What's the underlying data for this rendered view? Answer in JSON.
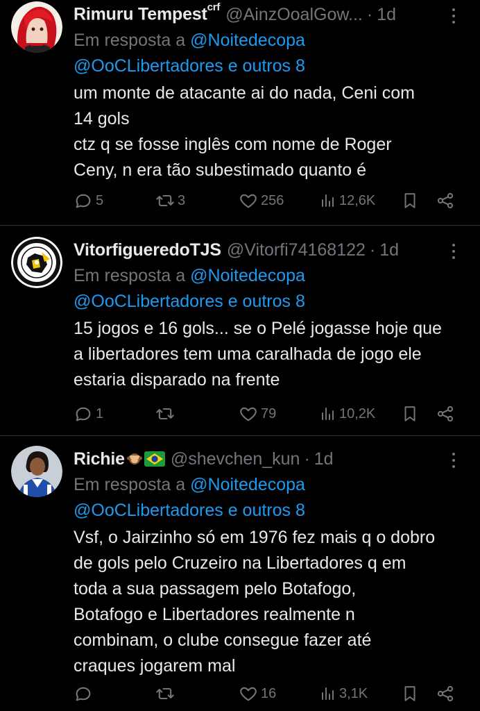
{
  "tweets": [
    {
      "name": "Rimuru Tempest",
      "name_suffix": "crf",
      "handle": "@AinzOoalGow...",
      "time": "1d",
      "reply_prefix": "Em resposta a",
      "reply_first": "@Noitedecopa",
      "reply_second": "@OoCLibertadores e outros 8",
      "text": "um monte de atacante ai do nada, Ceni com\n14 gols\nctz q se fosse inglês com nome de Roger\nCeny, n era tão subestimado quanto é",
      "replies": "5",
      "retweets": "3",
      "likes": "256",
      "views": "12,6K"
    },
    {
      "name": "VitorfigueredoTJS",
      "handle": "@Vitorfi74168122",
      "time": "1d",
      "reply_prefix": "Em resposta a",
      "reply_first": "@Noitedecopa",
      "reply_second": "@OoCLibertadores e outros 8",
      "text": "15 jogos e 16 gols... se o Pelé jogasse hoje que\na libertadores tem uma caralhada de jogo ele\nestaria disparado na frente",
      "replies": "1",
      "retweets": "",
      "likes": "79",
      "views": "10,2K",
      "avatar_text": "TORCIDA JOVEM"
    },
    {
      "name": "Richie",
      "handle": "@shevchen_kun",
      "time": "1d",
      "reply_prefix": "Em resposta a",
      "reply_first": "@Noitedecopa",
      "reply_second": "@OoCLibertadores e outros 8",
      "text": "Vsf, o Jairzinho só em 1976 fez mais q o dobro\nde gols pelo Cruzeiro na Libertadores q em\ntoda a sua passagem pelo Botafogo,\nBotafogo e Libertadores realmente n\ncombinam, o clube consegue fazer até\ncraques jogarem mal",
      "replies": "",
      "retweets": "",
      "likes": "16",
      "views": "3,1K"
    }
  ],
  "colors": {
    "background": "#000000",
    "text": "#e7e9ea",
    "muted": "#71767b",
    "link": "#1d9bf0",
    "divider": "#2f3336"
  },
  "icons": [
    "reply-icon",
    "retweet-icon",
    "like-icon",
    "views-icon",
    "bookmark-icon",
    "share-icon",
    "more-icon"
  ]
}
